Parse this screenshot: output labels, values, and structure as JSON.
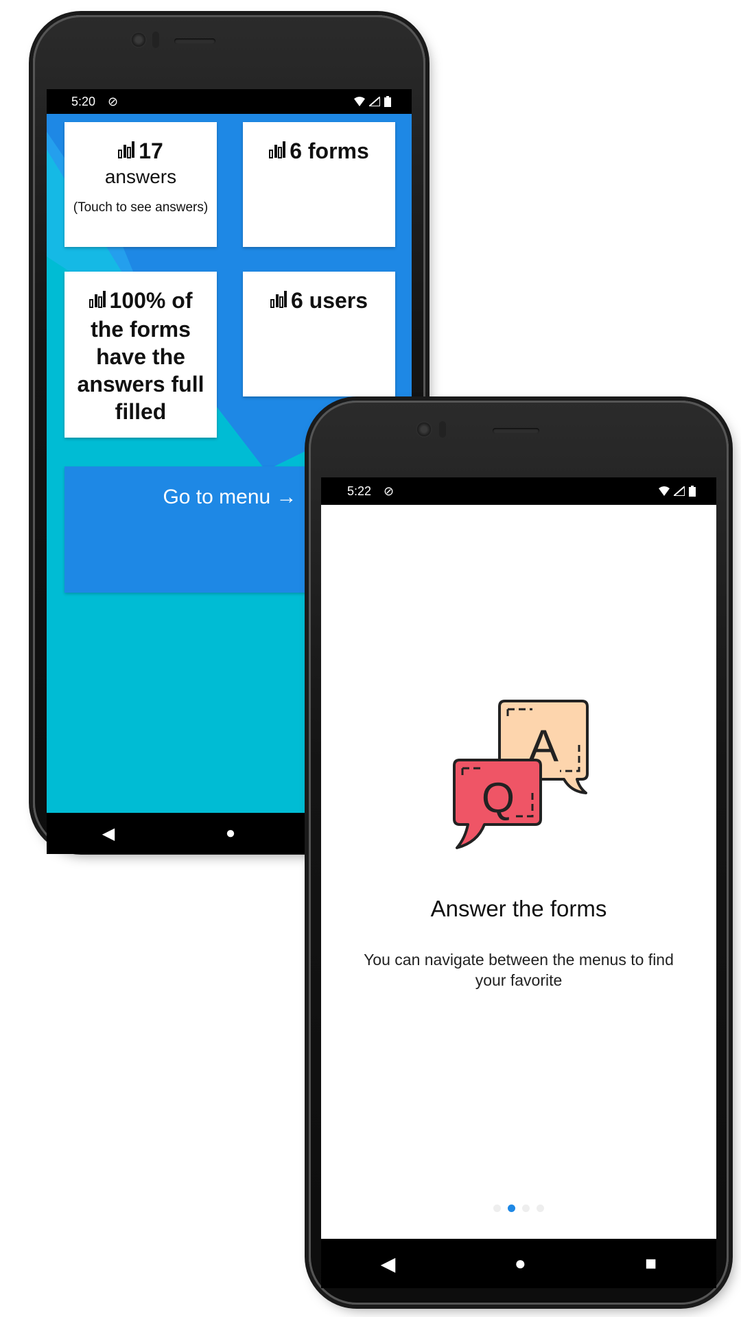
{
  "phone1": {
    "status": {
      "time": "5:20"
    },
    "cards": {
      "answers": {
        "count": "17",
        "unit": "answers",
        "hint": "(Touch to see answers)"
      },
      "forms": {
        "text": "6 forms"
      },
      "full": {
        "percent": "100% of",
        "rest": "the forms have the answers full filled"
      },
      "users": {
        "text": "6 users"
      }
    },
    "menu_button": "Go to menu →"
  },
  "phone2": {
    "status": {
      "time": "5:22"
    },
    "illustration": {
      "answer_letter": "A",
      "question_letter": "Q"
    },
    "title": "Answer the forms",
    "description": "You can navigate between the menus to find your favorite",
    "pager": {
      "total": 4,
      "active": 1
    }
  },
  "icons": {
    "stat": "bar-chart-icon",
    "sync": "no-sync-icon",
    "wifi": "wifi-icon",
    "signal": "signal-icon",
    "battery": "battery-icon",
    "back": "back-icon",
    "home": "home-icon",
    "recents": "recents-icon"
  },
  "colors": {
    "primary_blue": "#1e88e5",
    "cyan": "#00bcd4",
    "answer_bubble": "#fdd5ad",
    "question_bubble": "#ef5566"
  }
}
